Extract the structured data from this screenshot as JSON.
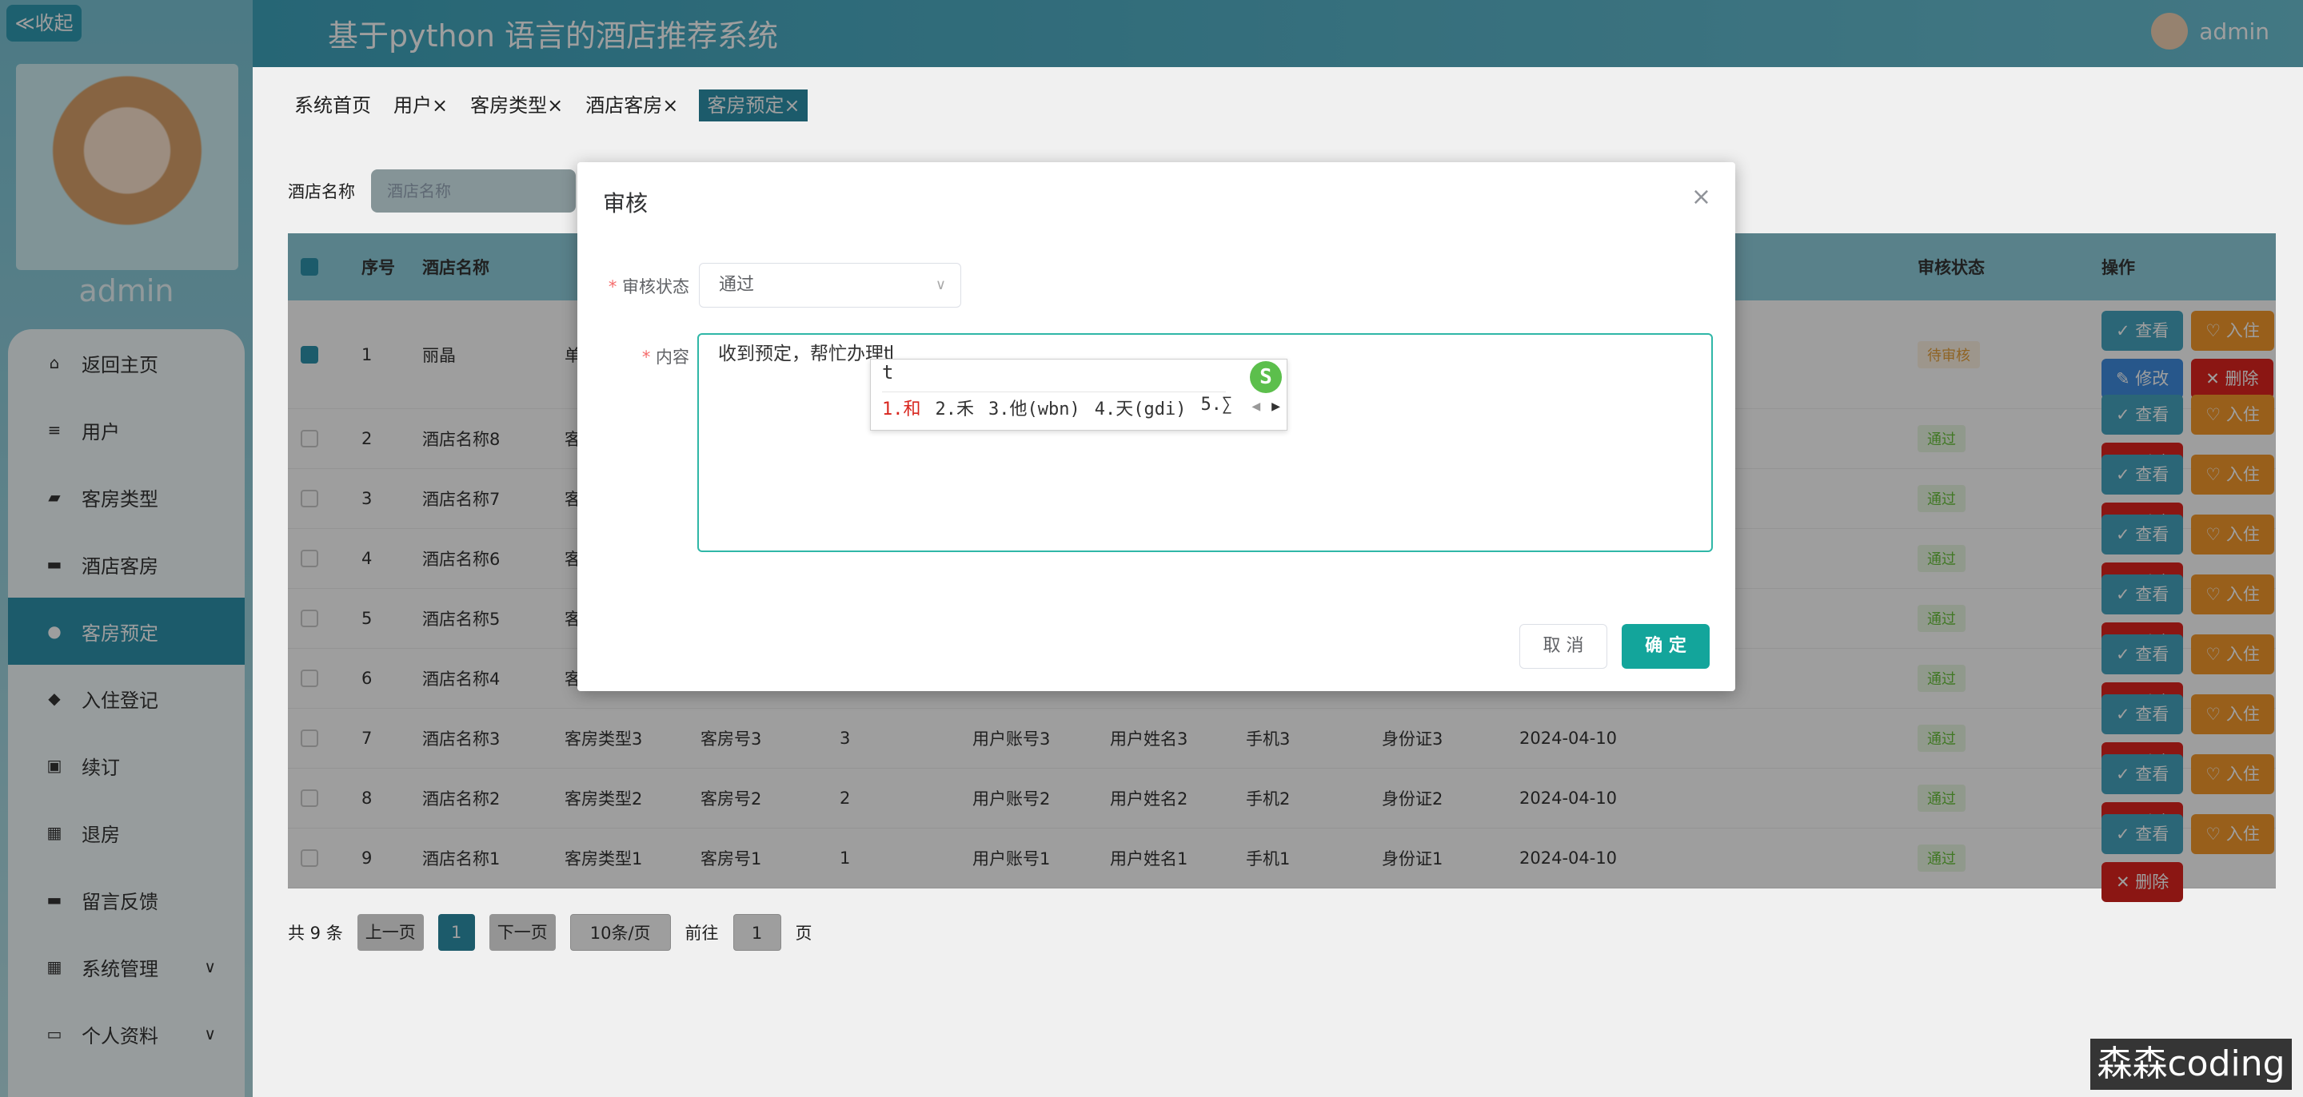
{
  "sidebar": {
    "collapse_label": "≪收起",
    "username": "admin",
    "menu": [
      {
        "label": "返回主页",
        "icon": "home-icon"
      },
      {
        "label": "用户",
        "icon": "list-icon"
      },
      {
        "label": "客房类型",
        "icon": "wallet-icon"
      },
      {
        "label": "酒店客房",
        "icon": "monitor-icon"
      },
      {
        "label": "客房预定",
        "icon": "user-icon",
        "active": true
      },
      {
        "label": "入住登记",
        "icon": "location-icon"
      },
      {
        "label": "续订",
        "icon": "clipboard-icon"
      },
      {
        "label": "退房",
        "icon": "grid-icon"
      },
      {
        "label": "留言反馈",
        "icon": "monitor-icon"
      },
      {
        "label": "系统管理",
        "icon": "apps-icon",
        "expandable": true
      },
      {
        "label": "个人资料",
        "icon": "card-icon",
        "expandable": true
      }
    ]
  },
  "header": {
    "title": "基于python 语言的酒店推荐系统",
    "user": "admin"
  },
  "tabs": [
    {
      "label": "系统首页"
    },
    {
      "label": "用户×"
    },
    {
      "label": "客房类型×"
    },
    {
      "label": "酒店客房×"
    },
    {
      "label": "客房预定×",
      "active": true
    }
  ],
  "search": {
    "label": "酒店名称",
    "placeholder": "酒店名称"
  },
  "table": {
    "headers": [
      "序号",
      "酒店名称",
      "",
      "",
      "",
      "",
      "",
      "",
      "",
      "",
      "",
      "审核状态",
      "操作"
    ],
    "rows": [
      {
        "idx": "1",
        "hotel": "丽晶",
        "type": "单",
        "room": "",
        "num": "",
        "account": "",
        "name": "",
        "phone": "",
        "idcard": "",
        "date": "",
        "status": "待审核",
        "checked": true
      },
      {
        "idx": "2",
        "hotel": "酒店名称8",
        "type": "客",
        "room": "",
        "num": "",
        "account": "",
        "name": "",
        "phone": "",
        "idcard": "",
        "date": "",
        "status": "通过"
      },
      {
        "idx": "3",
        "hotel": "酒店名称7",
        "type": "客",
        "room": "",
        "num": "",
        "account": "",
        "name": "",
        "phone": "",
        "idcard": "",
        "date": "",
        "status": "通过"
      },
      {
        "idx": "4",
        "hotel": "酒店名称6",
        "type": "客",
        "room": "",
        "num": "",
        "account": "",
        "name": "",
        "phone": "",
        "idcard": "",
        "date": "",
        "status": "通过"
      },
      {
        "idx": "5",
        "hotel": "酒店名称5",
        "type": "客",
        "room": "",
        "num": "",
        "account": "",
        "name": "",
        "phone": "",
        "idcard": "",
        "date": "",
        "status": "通过"
      },
      {
        "idx": "6",
        "hotel": "酒店名称4",
        "type": "客",
        "room": "",
        "num": "",
        "account": "",
        "name": "",
        "phone": "",
        "idcard": "",
        "date": "",
        "status": "通过"
      },
      {
        "idx": "7",
        "hotel": "酒店名称3",
        "type": "客房类型3",
        "room": "客房号3",
        "num": "3",
        "account": "用户账号3",
        "name": "用户姓名3",
        "phone": "手机3",
        "idcard": "身份证3",
        "date": "2024-04-10",
        "status": "通过"
      },
      {
        "idx": "8",
        "hotel": "酒店名称2",
        "type": "客房类型2",
        "room": "客房号2",
        "num": "2",
        "account": "用户账号2",
        "name": "用户姓名2",
        "phone": "手机2",
        "idcard": "身份证2",
        "date": "2024-04-10",
        "status": "通过"
      },
      {
        "idx": "9",
        "hotel": "酒店名称1",
        "type": "客房类型1",
        "room": "客房号1",
        "num": "1",
        "account": "用户账号1",
        "name": "用户姓名1",
        "phone": "手机1",
        "idcard": "身份证1",
        "date": "2024-04-10",
        "status": "通过"
      }
    ],
    "ops": {
      "view": "✓ 查看",
      "live": "♡ 入住",
      "edit": "✎ 修改",
      "del": "✕ 删除"
    }
  },
  "pager": {
    "total": "共 9 条",
    "prev": "上一页",
    "current": "1",
    "next": "下一页",
    "size": "10条/页",
    "goto": "前往",
    "goto_value": "1",
    "page": "页"
  },
  "modal": {
    "title": "审核",
    "status_label": "审核状态",
    "status_value": "通过",
    "content_label": "内容",
    "content_value": "收到预定，帮忙办理t",
    "cancel": "取 消",
    "ok": "确 定"
  },
  "ime": {
    "input": "t",
    "logo": "S",
    "candidates": [
      "1.和",
      "2.禾",
      "3.他(wbn)",
      "4.天(gdi)",
      "5.∑"
    ]
  },
  "watermark": "森森coding"
}
